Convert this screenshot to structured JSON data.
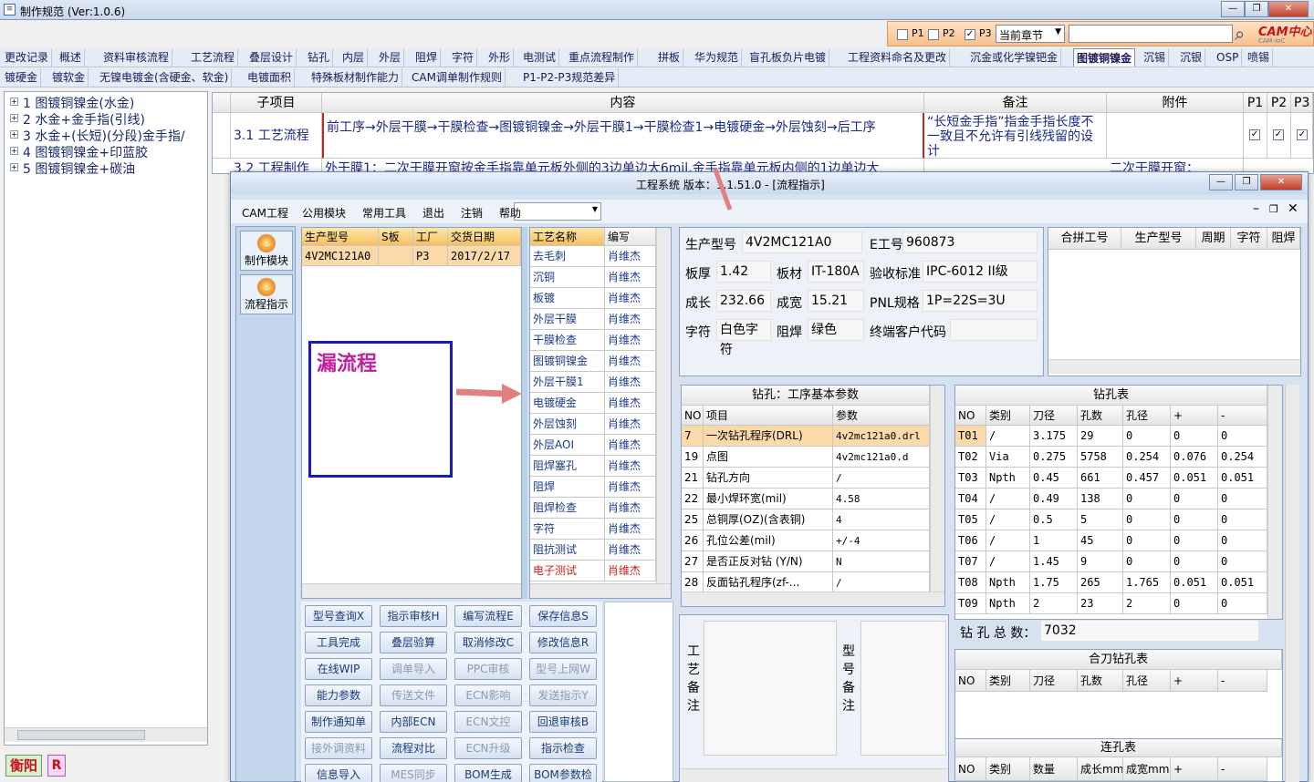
{
  "main_window": {
    "title": "制作规范 (Ver:1.0.6)"
  },
  "filter": {
    "p1": "P1",
    "p2": "P2",
    "p3": "P3",
    "chapter": "当前章节",
    "logo": "CAM中心",
    "logo_sub": "CAM-IoC"
  },
  "tabs_row1": [
    "更改记录",
    "概述",
    "资料审核流程",
    "工艺流程",
    "叠层设计",
    "钻孔",
    "内层",
    "外层",
    "阻焊",
    "字符",
    "外形",
    "电测试",
    "重点流程制作",
    "拼板",
    "华为规范",
    "盲孔板负片电镀",
    "工程资料命名及更改",
    "沉金或化学镍钯金",
    "图镀铜镍金",
    "沉锡",
    "沉银",
    "OSP",
    "喷锡"
  ],
  "tabs_row2": [
    "镀硬金",
    "镀软金",
    "无镍电镀金(含硬金、软金)",
    "电镀面积",
    "特殊板材制作能力",
    "CAM调单制作规则",
    "P1-P2-P3规范差异"
  ],
  "tree": [
    "1  图镀铜镍金(水金)",
    "2  水金+金手指(引线)",
    "3  水金+(长短)(分段)金手指/",
    "4  图镀铜镍金+印蓝胶",
    "5  图镀铜镍金+碳油"
  ],
  "spec_table": {
    "headers": [
      "子项目",
      "内容",
      "备注",
      "附件",
      "P1",
      "P2",
      "P3"
    ],
    "rows": [
      {
        "sub": "3.1  工艺流程",
        "content": "前工序→外层干膜→干膜检查→图镀铜镍金→外层干膜1→干膜检查1→电镀硬金→外层蚀刻→后工序",
        "note": "“长短金手指”指金手指长度不一致且不允许有引线残留的设计"
      },
      {
        "sub": "3.2  工程制作",
        "content": "外干膜1：二次干膜开窗按金手指靠单元板外侧的3边单边大6mil,金手指靠单元板内侧的1边单边大",
        "attach": "二次干膜开窗："
      }
    ]
  },
  "bottom_left": {
    "city": "衡阳",
    "r": "R"
  },
  "eng": {
    "title": "工程系统  版本：1.1.51.0 - [流程指示]",
    "menu": [
      "CAM工程",
      "公用模块",
      "常用工具",
      "退出",
      "注销",
      "帮助"
    ],
    "side_buttons": [
      "制作模块",
      "流程指示"
    ],
    "model_table": {
      "headers": [
        "生产型号",
        "S板",
        "工厂",
        "交货日期"
      ],
      "row": [
        "4V2MC121A0",
        "",
        "P3",
        "2017/2/17"
      ]
    },
    "annotation": "漏流程",
    "process": {
      "headers": [
        "工艺名称",
        "编写"
      ],
      "rows": [
        [
          "去毛刺",
          "肖维杰"
        ],
        [
          "沉铜",
          "肖维杰"
        ],
        [
          "板镀",
          "肖维杰"
        ],
        [
          "外层干膜",
          "肖维杰"
        ],
        [
          "干膜检查",
          "肖维杰"
        ],
        [
          "图镀铜镍金",
          "肖维杰"
        ],
        [
          "外层干膜1",
          "肖维杰"
        ],
        [
          "电镀硬金",
          "肖维杰"
        ],
        [
          "外层蚀刻",
          "肖维杰"
        ],
        [
          "外层AOI",
          "肖维杰"
        ],
        [
          "阻焊塞孔",
          "肖维杰"
        ],
        [
          "阻焊",
          "肖维杰"
        ],
        [
          "阻焊检查",
          "肖维杰"
        ],
        [
          "字符",
          "肖维杰"
        ],
        [
          "阻抗测试",
          "肖维杰"
        ],
        [
          "电子测试",
          "肖维杰"
        ]
      ]
    },
    "buttons": [
      [
        "型号查询X",
        "指示审核H",
        "编写流程E",
        "保存信息S"
      ],
      [
        "工具完成",
        "叠层验算",
        "取消修改C",
        "修改信息R"
      ],
      [
        "在线WIP",
        "调单导入",
        "PPC审核",
        "型号上网W"
      ],
      [
        "能力参数",
        "传送文件",
        "ECN影响",
        "发送指示Y"
      ],
      [
        "制作通知单",
        "内部ECN",
        "ECN文控",
        "回退审核B"
      ],
      [
        "接外调资料",
        "流程对比",
        "ECN升级",
        "指示检查"
      ],
      [
        "信息导入",
        "MES同步",
        "BOM生成",
        "BOM参数检查"
      ]
    ],
    "buttons_disabled": [
      [
        false,
        false,
        false,
        false
      ],
      [
        false,
        false,
        false,
        false
      ],
      [
        false,
        true,
        true,
        true
      ],
      [
        false,
        true,
        true,
        true
      ],
      [
        false,
        false,
        true,
        false
      ],
      [
        true,
        false,
        true,
        false
      ],
      [
        false,
        true,
        false,
        false
      ]
    ],
    "info": {
      "model_label": "生产型号",
      "model": "4V2MC121A0",
      "e_label": "E工号",
      "e": "960873",
      "thick_label": "板厚",
      "thick": "1.42",
      "mat_label": "板材",
      "mat": "IT-180A",
      "std_label": "验收标准",
      "std": "IPC-6012 II级",
      "len_label": "成长",
      "len": "232.66",
      "wid_label": "成宽",
      "wid": "15.21",
      "pnl_label": "PNL规格",
      "pnl": "1P=22S=3U",
      "char_label": "字符",
      "char": "白色字符",
      "mask_label": "阻焊",
      "mask": "绿色",
      "cust_label": "终端客户代码"
    },
    "merge_headers": [
      "合拼工号",
      "生产型号",
      "周期",
      "字符",
      "阻焊"
    ],
    "drill_params": {
      "title": "钻孔：工序基本参数",
      "headers": [
        "NO",
        "项目",
        "参数"
      ],
      "rows": [
        [
          "7",
          "一次钻孔程序(DRL)",
          "4v2mc121a0.drl"
        ],
        [
          "19",
          "点图",
          "4v2mc121a0.d"
        ],
        [
          "21",
          "钻孔方向",
          "/"
        ],
        [
          "22",
          "最小焊环宽(mil)",
          "4.58"
        ],
        [
          "25",
          "总铜厚(OZ)(含表铜)",
          "4"
        ],
        [
          "26",
          "孔位公差(mil)",
          "+/-4"
        ],
        [
          "27",
          "是否正反对钻 (Y/N)",
          "N"
        ],
        [
          "28",
          "反面钻孔程序(zf-...",
          "/"
        ]
      ]
    },
    "drill_table": {
      "title": "钻孔表",
      "headers": [
        "NO",
        "类别",
        "刀径",
        "孔数",
        "孔径",
        "+",
        "-"
      ],
      "rows": [
        [
          "T01",
          "/",
          "3.175",
          "29",
          "0",
          "0",
          "0"
        ],
        [
          "T02",
          "Via",
          "0.275",
          "5758",
          "0.254",
          "0.076",
          "0.254"
        ],
        [
          "T03",
          "Npth",
          "0.45",
          "661",
          "0.457",
          "0.051",
          "0.051"
        ],
        [
          "T04",
          "/",
          "0.49",
          "138",
          "0",
          "0",
          "0"
        ],
        [
          "T05",
          "/",
          "0.5",
          "5",
          "0",
          "0",
          "0"
        ],
        [
          "T06",
          "/",
          "1",
          "45",
          "0",
          "0",
          "0"
        ],
        [
          "T07",
          "/",
          "1.45",
          "9",
          "0",
          "0",
          "0"
        ],
        [
          "T08",
          "Npth",
          "1.75",
          "265",
          "1.765",
          "0.051",
          "0.051"
        ],
        [
          "T09",
          "Npth",
          "2",
          "23",
          "2",
          "0",
          "0"
        ]
      ]
    },
    "drill_total_label": "钻 孔 总 数：",
    "drill_total": "7032",
    "merge_knife": {
      "title": "合刀钻孔表",
      "headers": [
        "NO",
        "类别",
        "刀径",
        "孔数",
        "孔径",
        "+",
        "-"
      ]
    },
    "slot": {
      "title": "连孔表",
      "headers": [
        "NO",
        "类别",
        "数量",
        "成长mm",
        "成宽mm",
        "+",
        "-"
      ]
    },
    "process_note": "工艺备注",
    "model_note": "型号备注"
  }
}
